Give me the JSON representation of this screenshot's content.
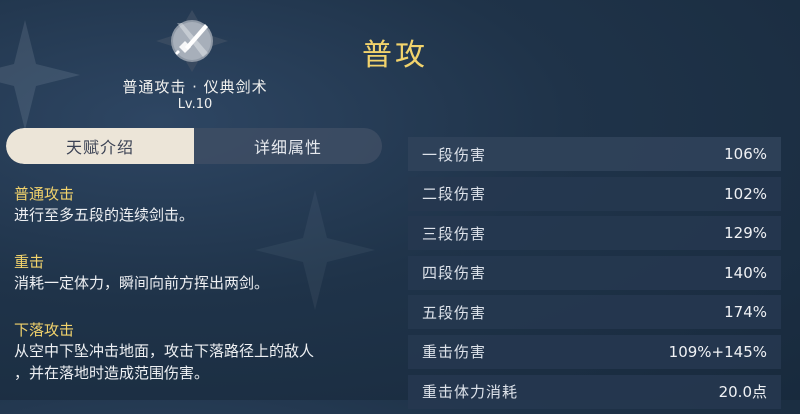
{
  "skill": {
    "title": "普攻",
    "name": "普通攻击 · 仪典剑术",
    "level": "Lv.10",
    "icon": "sword-icon"
  },
  "tabs": [
    {
      "label": "天赋介绍",
      "active": true
    },
    {
      "label": "详细属性",
      "active": false
    }
  ],
  "description": [
    {
      "heading": "普通攻击",
      "lines": [
        "进行至多五段的连续剑击。"
      ]
    },
    {
      "heading": "重击",
      "lines": [
        "消耗一定体力，瞬间向前方挥出两剑。"
      ]
    },
    {
      "heading": "下落攻击",
      "lines": [
        "从空中下坠冲击地面，攻击下落路径上的敌人",
        "，并在落地时造成范围伤害。"
      ]
    }
  ],
  "stats": [
    {
      "label": "一段伤害",
      "value": "106%"
    },
    {
      "label": "二段伤害",
      "value": "102%"
    },
    {
      "label": "三段伤害",
      "value": "129%"
    },
    {
      "label": "四段伤害",
      "value": "140%"
    },
    {
      "label": "五段伤害",
      "value": "174%"
    },
    {
      "label": "重击伤害",
      "value": "109%+145%"
    },
    {
      "label": "重击体力消耗",
      "value": "20.0点"
    }
  ],
  "colors": {
    "accent_gold": "#f2d36c",
    "active_tab_bg": "#ece5d8",
    "row_bg": "#263850"
  }
}
